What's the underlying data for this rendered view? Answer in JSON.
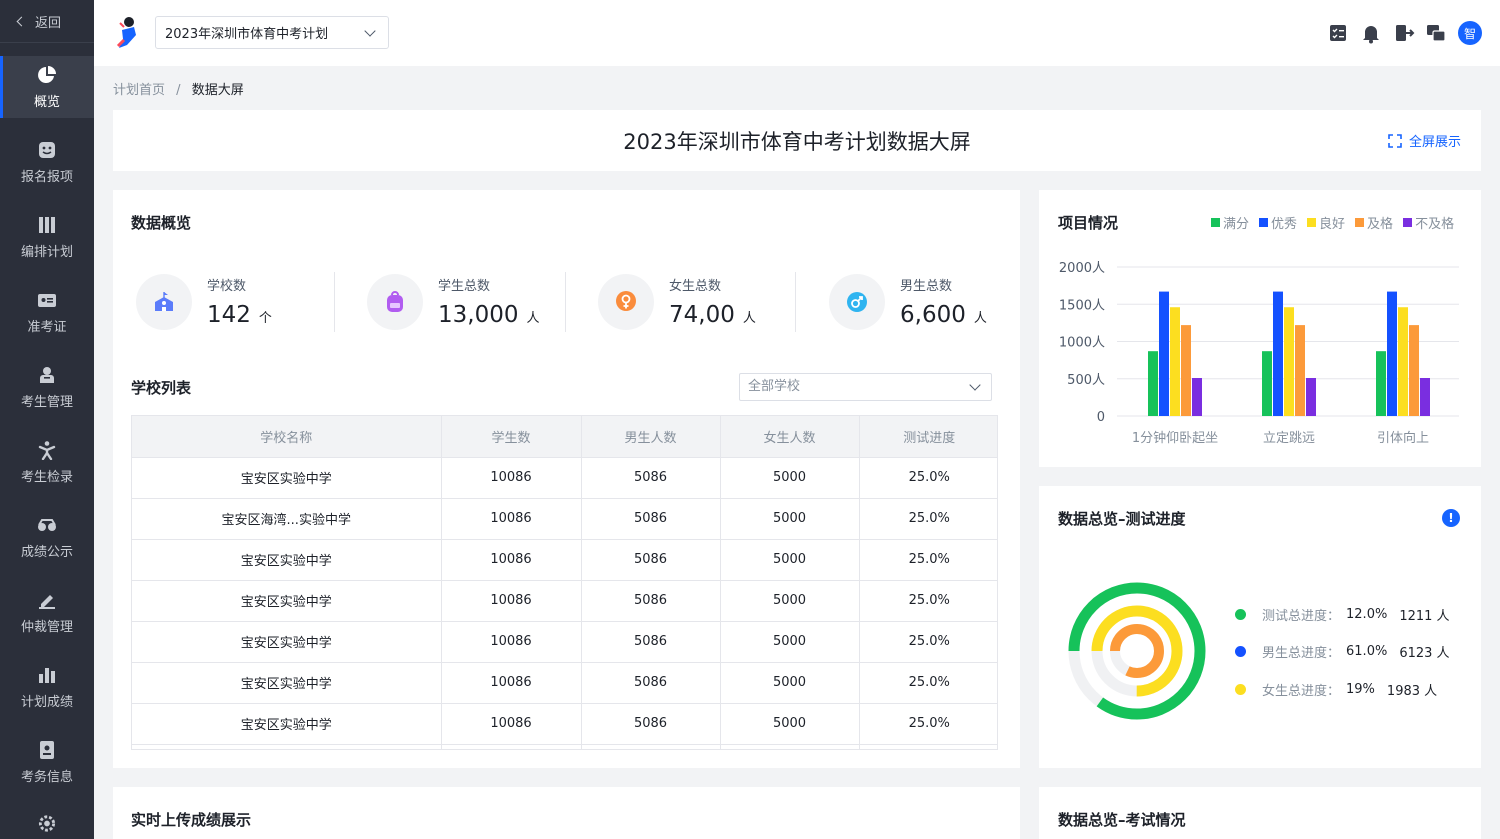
{
  "sidebar": {
    "back_label": "返回",
    "items": [
      {
        "label": "概览",
        "icon": "pie-chart-icon"
      },
      {
        "label": "报名报项",
        "icon": "emoji-icon"
      },
      {
        "label": "编排计划",
        "icon": "columns-icon"
      },
      {
        "label": "准考证",
        "icon": "id-card-icon"
      },
      {
        "label": "考生管理",
        "icon": "student-icon"
      },
      {
        "label": "考生检录",
        "icon": "figure-icon"
      },
      {
        "label": "成绩公示",
        "icon": "glasses-icon"
      },
      {
        "label": "仲裁管理",
        "icon": "pen-icon"
      },
      {
        "label": "计划成绩",
        "icon": "bar-chart-icon"
      },
      {
        "label": "考务信息",
        "icon": "badge-icon"
      },
      {
        "label": "",
        "icon": "gear-icon"
      }
    ]
  },
  "topbar": {
    "plan_select": "2023年深圳市体育中考计划",
    "avatar_text": "智"
  },
  "breadcrumb": {
    "home": "计划首页",
    "separator": "/",
    "current": "数据大屏"
  },
  "page": {
    "title": "2023年深圳市体育中考计划数据大屏",
    "fullscreen_label": "全屏展示"
  },
  "overview": {
    "title": "数据概览",
    "stats": [
      {
        "label": "学校数",
        "value": "142",
        "unit": "个",
        "icon": "school-icon",
        "color": "#5b7cfa"
      },
      {
        "label": "学生总数",
        "value": "13,000",
        "unit": "人",
        "icon": "backpack-icon",
        "color": "#b15cf0"
      },
      {
        "label": "女生总数",
        "value": "74,00",
        "unit": "人",
        "icon": "female-icon",
        "color": "#fa8c3c"
      },
      {
        "label": "男生总数",
        "value": "6,600",
        "unit": "人",
        "icon": "male-icon",
        "color": "#2fb4f0"
      }
    ]
  },
  "schools": {
    "title": "学校列表",
    "filter": "全部学校",
    "columns": [
      "学校名称",
      "学生数",
      "男生人数",
      "女生人数",
      "测试进度"
    ],
    "rows": [
      [
        "宝安区实验中学",
        "10086",
        "5086",
        "5000",
        "25.0%"
      ],
      [
        "宝安区海湾...实验中学",
        "10086",
        "5086",
        "5000",
        "25.0%"
      ],
      [
        "宝安区实验中学",
        "10086",
        "5086",
        "5000",
        "25.0%"
      ],
      [
        "宝安区实验中学",
        "10086",
        "5086",
        "5000",
        "25.0%"
      ],
      [
        "宝安区实验中学",
        "10086",
        "5086",
        "5000",
        "25.0%"
      ],
      [
        "宝安区实验中学",
        "10086",
        "5086",
        "5000",
        "25.0%"
      ],
      [
        "宝安区实验中学",
        "10086",
        "5086",
        "5000",
        "25.0%"
      ],
      [
        "",
        "",
        "",
        "",
        ""
      ]
    ]
  },
  "projects": {
    "title": "项目情况"
  },
  "chart_data": {
    "type": "bar",
    "categories": [
      "1分钟仰卧起坐",
      "立定跳远",
      "引体向上"
    ],
    "series": [
      {
        "name": "满分",
        "color": "#16c25a",
        "values": [
          870,
          870,
          870
        ]
      },
      {
        "name": "优秀",
        "color": "#1451ff",
        "values": [
          1670,
          1670,
          1670
        ]
      },
      {
        "name": "良好",
        "color": "#fcde20",
        "values": [
          1460,
          1460,
          1460
        ]
      },
      {
        "name": "及格",
        "color": "#fc9a3a",
        "values": [
          1220,
          1220,
          1220
        ]
      },
      {
        "name": "不及格",
        "color": "#7a2ee0",
        "values": [
          510,
          510,
          510
        ]
      }
    ],
    "ylim": [
      0,
      2000
    ],
    "yticks": [
      {
        "value": 0,
        "label": "0"
      },
      {
        "value": 500,
        "label": "500人"
      },
      {
        "value": 1000,
        "label": "1000人"
      },
      {
        "value": 1500,
        "label": "1500人"
      },
      {
        "value": 2000,
        "label": "2000人"
      }
    ],
    "legend": "top-right",
    "grid": true
  },
  "progress": {
    "title": "数据总览–测试进度",
    "info": "!",
    "rows": [
      {
        "label": "测试总进度：",
        "value": "12.0%",
        "count": "1211 人",
        "color": "#16c25a",
        "fraction": 0.85
      },
      {
        "label": "男生总进度：",
        "value": "61.0%",
        "count": "6123 人",
        "color": "#1451ff",
        "fraction": 0.61
      },
      {
        "label": "女生总进度：",
        "value": "19%",
        "count": "1983 人",
        "color": "#fcde20",
        "fraction": 0.75
      }
    ],
    "inner_ring": {
      "color": "#fc9a3a",
      "fraction": 0.82
    }
  },
  "realtime": {
    "title": "实时上传成绩展示"
  },
  "exam": {
    "title": "数据总览–考试情况"
  }
}
